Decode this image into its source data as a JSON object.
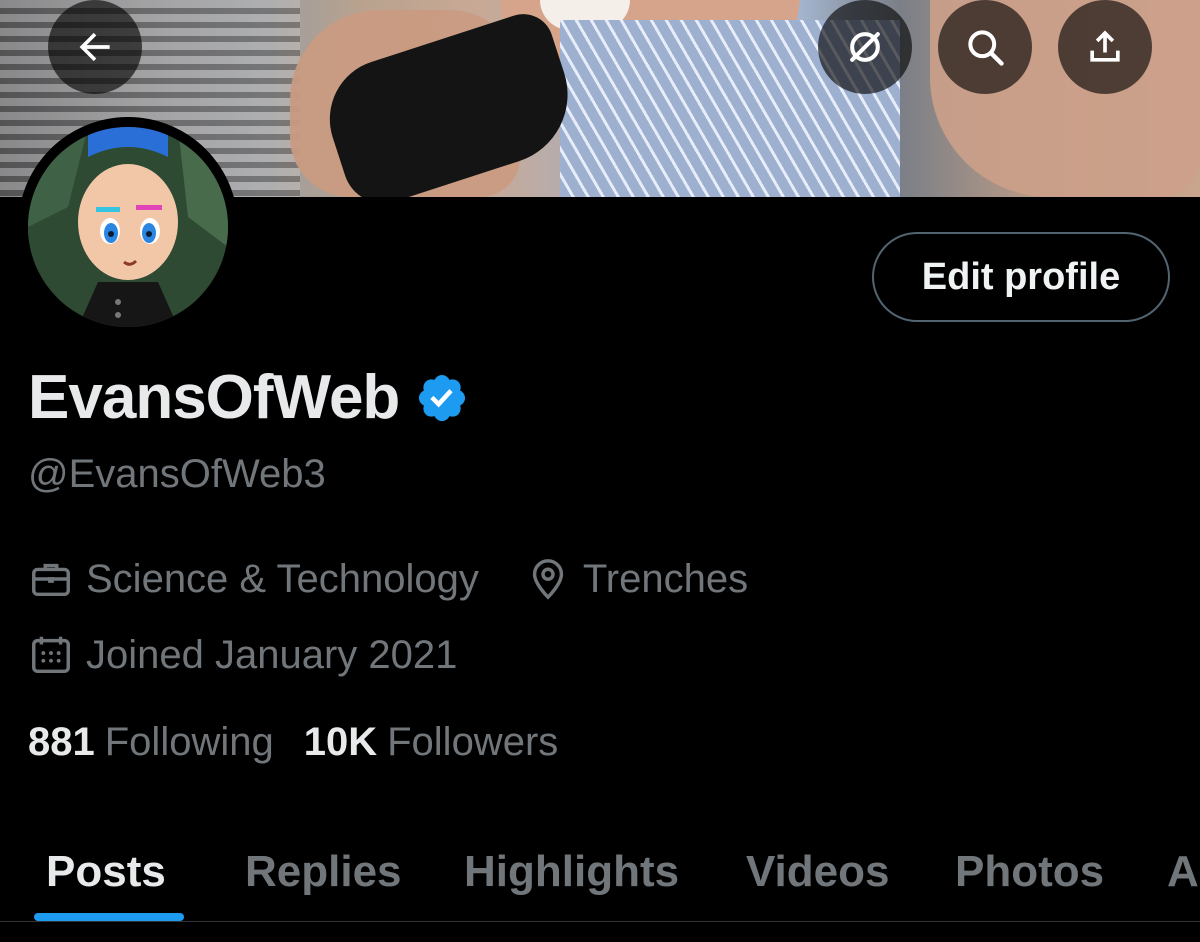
{
  "banner": {
    "description_icon": "banner-photo"
  },
  "header": {
    "back_icon": "arrow-left-icon",
    "grok_icon": "grok-icon",
    "search_icon": "search-icon",
    "share_icon": "share-icon"
  },
  "profile": {
    "display_name": "EvansOfWeb",
    "handle": "@EvansOfWeb3",
    "edit_label": "Edit profile",
    "category": "Science & Technology",
    "location": "Trenches",
    "joined": "Joined January 2021",
    "following_count": "881",
    "following_label": "Following",
    "followers_count": "10K",
    "followers_label": "Followers"
  },
  "tabs": [
    {
      "label": "Posts",
      "active": true
    },
    {
      "label": "Replies"
    },
    {
      "label": "Highlights"
    },
    {
      "label": "Videos"
    },
    {
      "label": "Photos"
    },
    {
      "label": "A"
    }
  ],
  "colors": {
    "accent": "#1d9bf0",
    "background": "#000000",
    "muted_text": "#71767b",
    "primary_text": "#e7e9ea"
  }
}
